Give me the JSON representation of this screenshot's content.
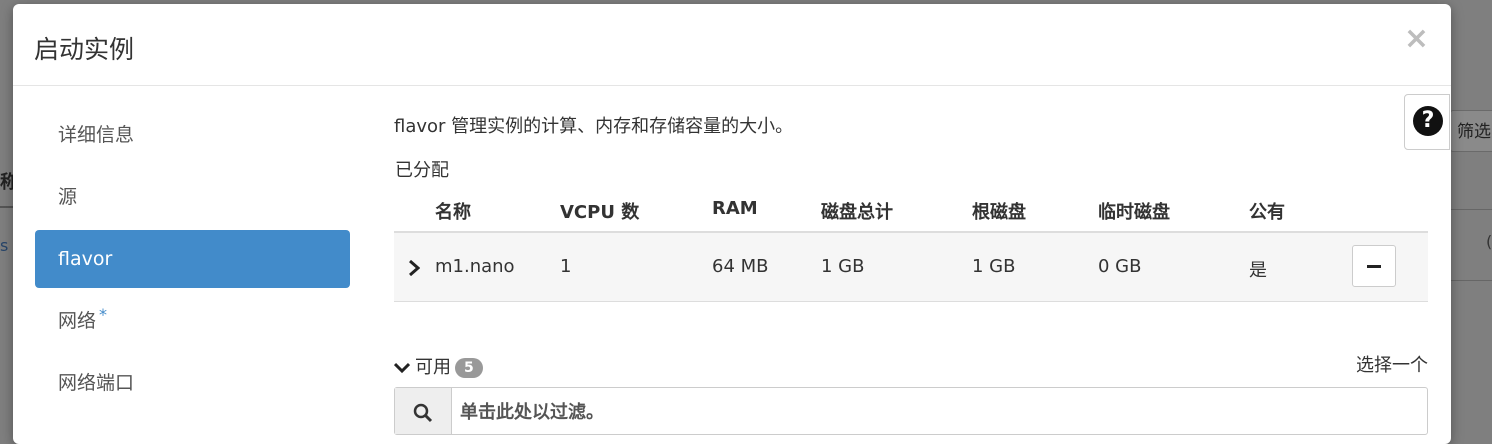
{
  "background": {
    "left_fragment": "称",
    "left_fragment2": "s",
    "right_filter_label": "筛选",
    "right_fragment": "  ",
    "right_fragment2": "("
  },
  "modal": {
    "title": "启动实例",
    "close_symbol": "×"
  },
  "nav": {
    "items": [
      {
        "label": "详细信息",
        "required": false
      },
      {
        "label": "源",
        "required": false
      },
      {
        "label": "flavor",
        "required": false,
        "active": true
      },
      {
        "label": "网络",
        "required": true,
        "marker": "*"
      },
      {
        "label": "网络端口",
        "required": false
      }
    ]
  },
  "content": {
    "description": "flavor 管理实例的计算、内存和存储容量的大小。",
    "allocated_label": "已分配",
    "columns": [
      "名称",
      "VCPU 数",
      "RAM",
      "磁盘总计",
      "根磁盘",
      "临时磁盘",
      "公有"
    ],
    "allocated_rows": [
      {
        "name": "m1.nano",
        "vcpu": "1",
        "ram": "64 MB",
        "disk_total": "1 GB",
        "root_disk": "1 GB",
        "ephemeral_disk": "0 GB",
        "public": "是"
      }
    ],
    "available_label": "可用",
    "available_count": "5",
    "select_one": "选择一个",
    "filter_placeholder": "单击此处以过滤。"
  },
  "help_button_symbol": "?",
  "colors": {
    "accent": "#428bca",
    "backdrop": "#7f7f7f"
  }
}
